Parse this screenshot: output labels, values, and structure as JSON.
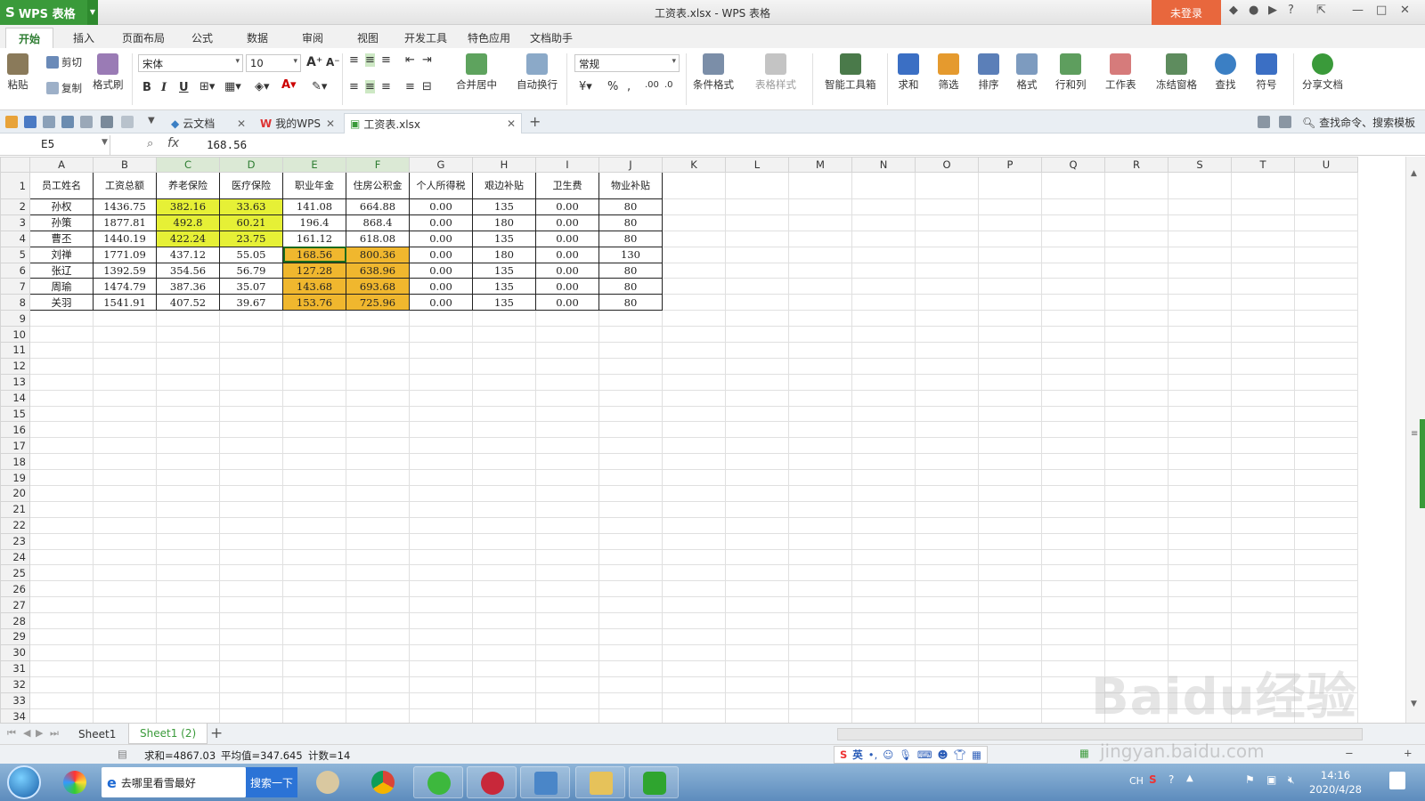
{
  "titlebar": {
    "app_button": "WPS 表格",
    "title": "工资表.xlsx - WPS 表格",
    "login": "未登录",
    "help": "?"
  },
  "ribbon_tabs": [
    "开始",
    "插入",
    "页面布局",
    "公式",
    "数据",
    "审阅",
    "视图",
    "开发工具",
    "特色应用",
    "文档助手"
  ],
  "ribbon": {
    "paste": "粘贴",
    "cut": "剪切",
    "copy": "复制",
    "format_painter": "格式刷",
    "font_name": "宋体",
    "font_size": "10",
    "merge_center": "合并居中",
    "auto_wrap": "自动换行",
    "number_format": "常规",
    "cond_format": "条件格式",
    "table_style": "表格样式",
    "smart_toolbox": "智能工具箱",
    "sum": "求和",
    "filter": "筛选",
    "sort": "排序",
    "format": "格式",
    "rows_cols": "行和列",
    "worksheet": "工作表",
    "freeze": "冻结窗格",
    "find": "查找",
    "symbol": "符号",
    "share": "分享文档"
  },
  "doc_tabs": {
    "cloud": "云文档",
    "mywps": "我的WPS",
    "file": "工资表.xlsx",
    "search": "查找命令、搜索模板"
  },
  "formula_bar": {
    "name_box": "E5",
    "fx": "fx",
    "value": "168.56"
  },
  "columns": [
    "A",
    "B",
    "C",
    "D",
    "E",
    "F",
    "G",
    "H",
    "I",
    "J",
    "K",
    "L",
    "M",
    "N",
    "O",
    "P",
    "Q",
    "R",
    "S",
    "T",
    "U"
  ],
  "headers": [
    "员工姓名",
    "工资总额",
    "养老保险",
    "医疗保险",
    "职业年金",
    "住房公积金",
    "个人所得税",
    "艰边补贴",
    "卫生费",
    "物业补贴"
  ],
  "rows": [
    [
      "孙权",
      "1436.75",
      "382.16",
      "33.63",
      "141.08",
      "664.88",
      "0.00",
      "135",
      "0.00",
      "80"
    ],
    [
      "孙策",
      "1877.81",
      "492.8",
      "60.21",
      "196.4",
      "868.4",
      "0.00",
      "180",
      "0.00",
      "80"
    ],
    [
      "曹丕",
      "1440.19",
      "422.24",
      "23.75",
      "161.12",
      "618.08",
      "0.00",
      "135",
      "0.00",
      "80"
    ],
    [
      "刘禅",
      "1771.09",
      "437.12",
      "55.05",
      "168.56",
      "800.36",
      "0.00",
      "180",
      "0.00",
      "130"
    ],
    [
      "张辽",
      "1392.59",
      "354.56",
      "56.79",
      "127.28",
      "638.96",
      "0.00",
      "135",
      "0.00",
      "80"
    ],
    [
      "周瑜",
      "1474.79",
      "387.36",
      "35.07",
      "143.68",
      "693.68",
      "0.00",
      "135",
      "0.00",
      "80"
    ],
    [
      "关羽",
      "1541.91",
      "407.52",
      "39.67",
      "153.76",
      "725.96",
      "0.00",
      "135",
      "0.00",
      "80"
    ]
  ],
  "highlight": {
    "yellow": "#e6f036",
    "orange": "#f0b72e",
    "accent": "#3a9a3a"
  },
  "sheet_tabs": [
    "Sheet1",
    "Sheet1 (2)"
  ],
  "status": {
    "sum": "求和=4867.03",
    "avg": "平均值=347.645",
    "count": "计数=14"
  },
  "taskbar": {
    "search_text": "去哪里看雪最好",
    "search_btn": "搜索一下",
    "time": "14:16",
    "date": "2020/4/28",
    "lang": "CH"
  },
  "watermark": {
    "brand": "Baidu经验",
    "url": "jingyan.baidu.com"
  }
}
